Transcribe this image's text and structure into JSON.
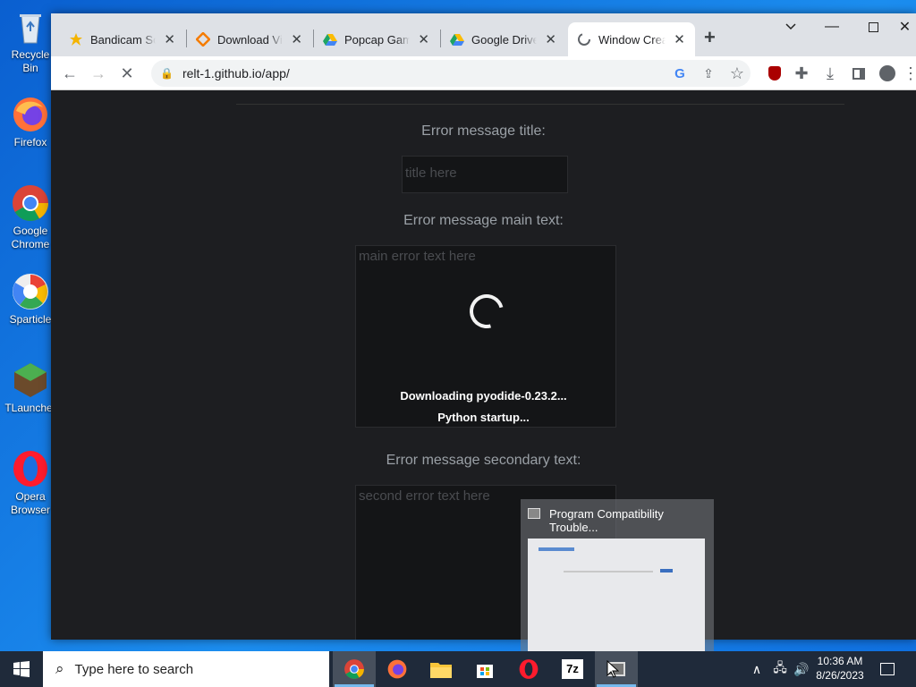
{
  "desktop": {
    "icons": [
      {
        "label": "Recycle Bin",
        "name": "recycle-bin"
      },
      {
        "label": "Firefox",
        "name": "firefox"
      },
      {
        "label": "Google Chrome",
        "name": "google-chrome"
      },
      {
        "label": "Sparticle",
        "name": "sparticle"
      },
      {
        "label": "TLauncher",
        "name": "tlauncher"
      },
      {
        "label": "Opera Browser",
        "name": "opera-browser"
      }
    ]
  },
  "browser": {
    "tabs": [
      {
        "label": "Bandicam Scre",
        "icon": "star-icon"
      },
      {
        "label": "Download Virt",
        "icon": "diamond-icon"
      },
      {
        "label": "Popcap Game",
        "icon": "google-drive-icon"
      },
      {
        "label": "Google Drive",
        "icon": "google-drive-icon"
      },
      {
        "label": "Window Creat",
        "icon": "globe-icon"
      }
    ],
    "url": "relt-1.github.io/app/"
  },
  "page": {
    "title_label": "Error message title:",
    "title_placeholder": "title here",
    "main_label": "Error message main text:",
    "main_placeholder": "main error text here",
    "secondary_label": "Error message secondary text:",
    "secondary_placeholder": "second error text here",
    "loading_line1": "Downloading pyodide-0.23.2...",
    "loading_line2": "Python startup..."
  },
  "thumbnail": {
    "title": "Program Compatibility Trouble..."
  },
  "taskbar": {
    "search_placeholder": "Type here to search",
    "time": "10:36 AM",
    "date": "8/26/2023"
  },
  "colors": {
    "taskbar_bg": "#1f2a3a",
    "page_bg": "#1d1e21",
    "accent": "#76b9ed"
  }
}
